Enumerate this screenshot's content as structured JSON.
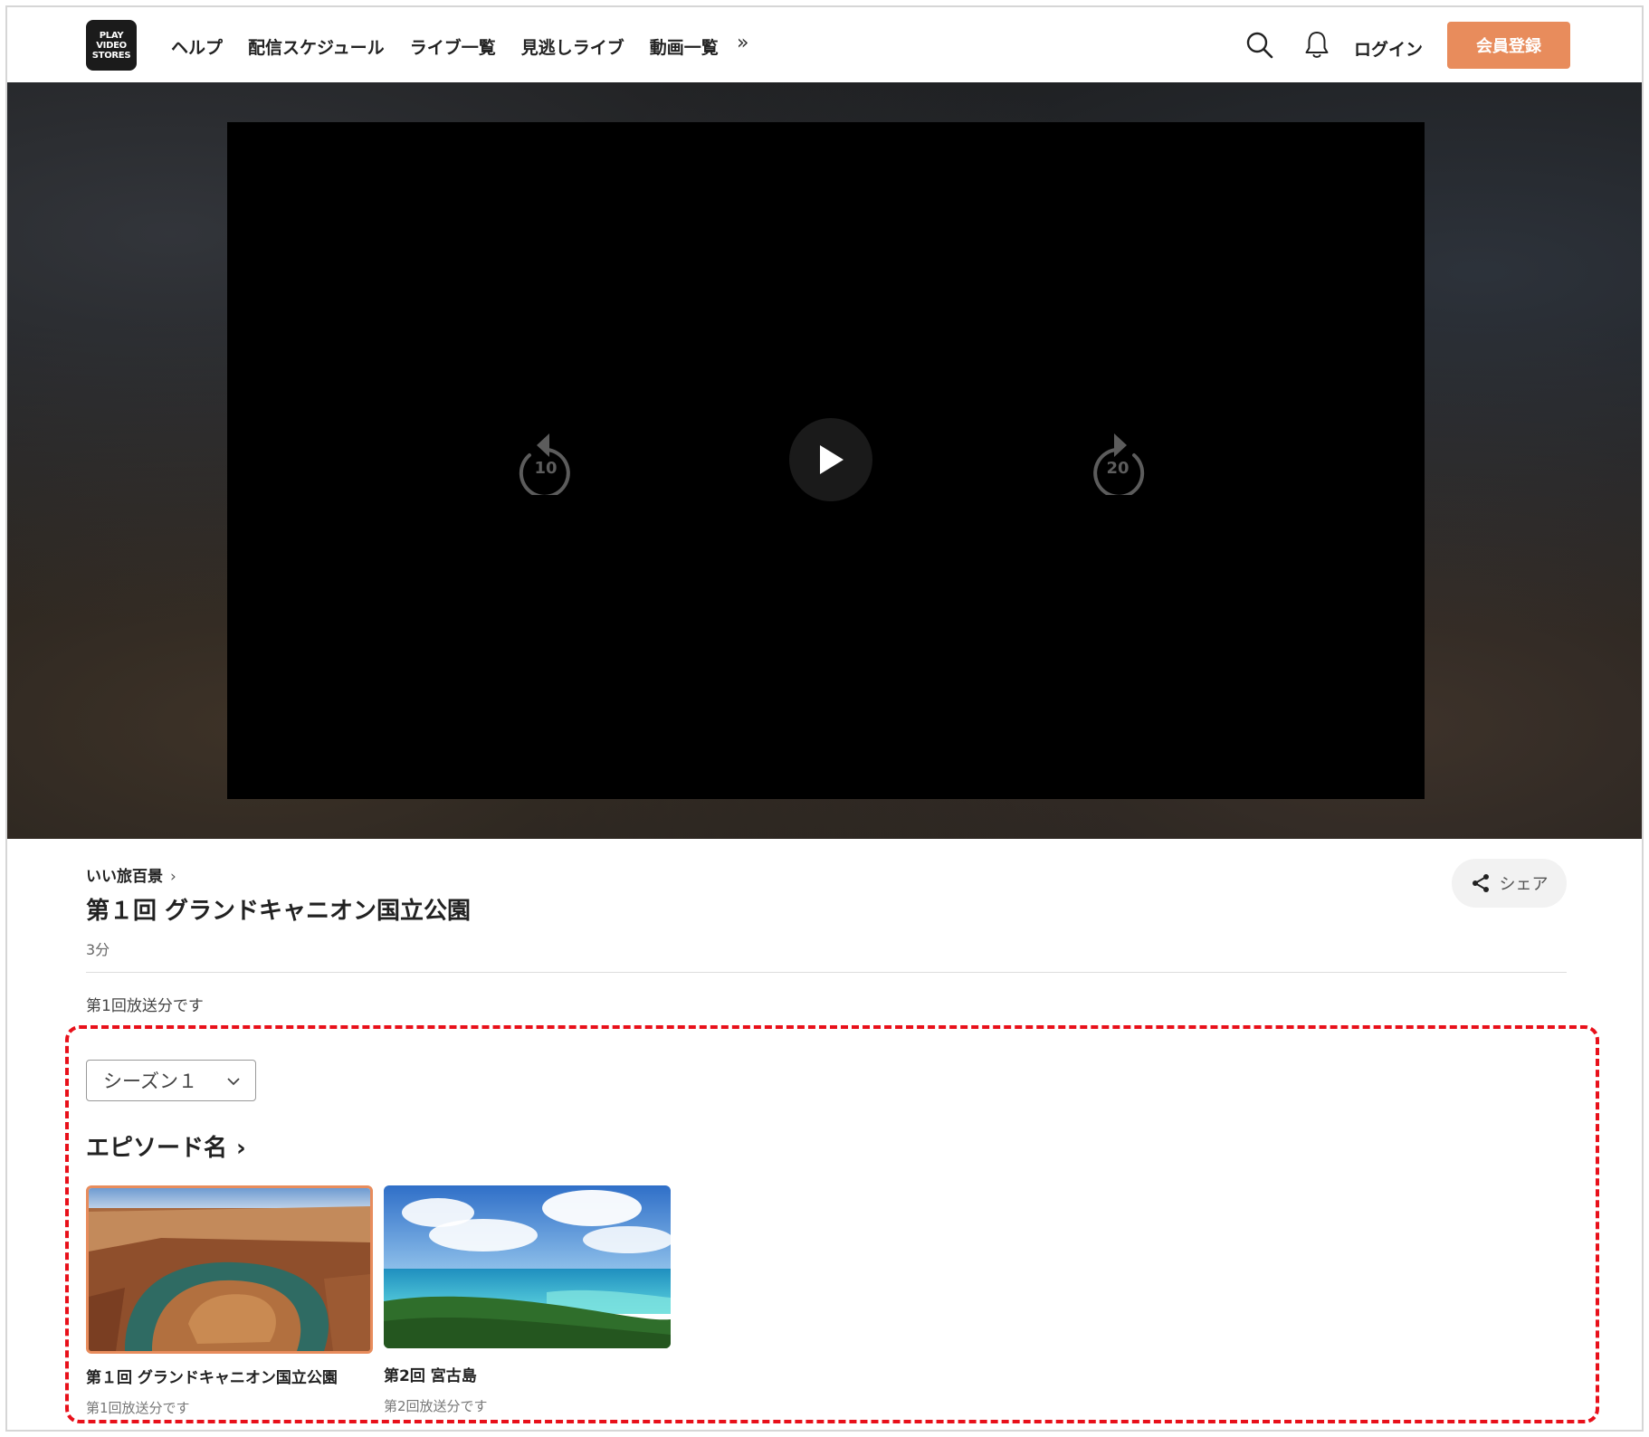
{
  "header": {
    "logo": [
      "PLAY",
      "VIDEO",
      "STORES"
    ],
    "nav": [
      "ヘルプ",
      "配信スケジュール",
      "ライブ一覧",
      "見逃しライブ",
      "動画一覧"
    ],
    "more_label": "»",
    "login_label": "ログイン",
    "signup_label": "会員登録",
    "signup_color": "#e88c5c"
  },
  "player": {
    "rewind_seconds": "10",
    "forward_seconds": "20"
  },
  "info": {
    "series": "いい旅百景",
    "series_chevron": "›",
    "title": "第１回 グランドキャニオン国立公園",
    "duration": "3分",
    "share_label": "シェア",
    "description": "第1回放送分です"
  },
  "episodes": {
    "season_label": "シーズン１",
    "heading": "エピソード名",
    "heading_chevron": "›",
    "items": [
      {
        "title": "第１回 グランドキャニオン国立公園",
        "desc": "第1回放送分です"
      },
      {
        "title": "第2回 宮古島",
        "desc": "第2回放送分です"
      }
    ]
  },
  "highlight_color": "#e8101a"
}
